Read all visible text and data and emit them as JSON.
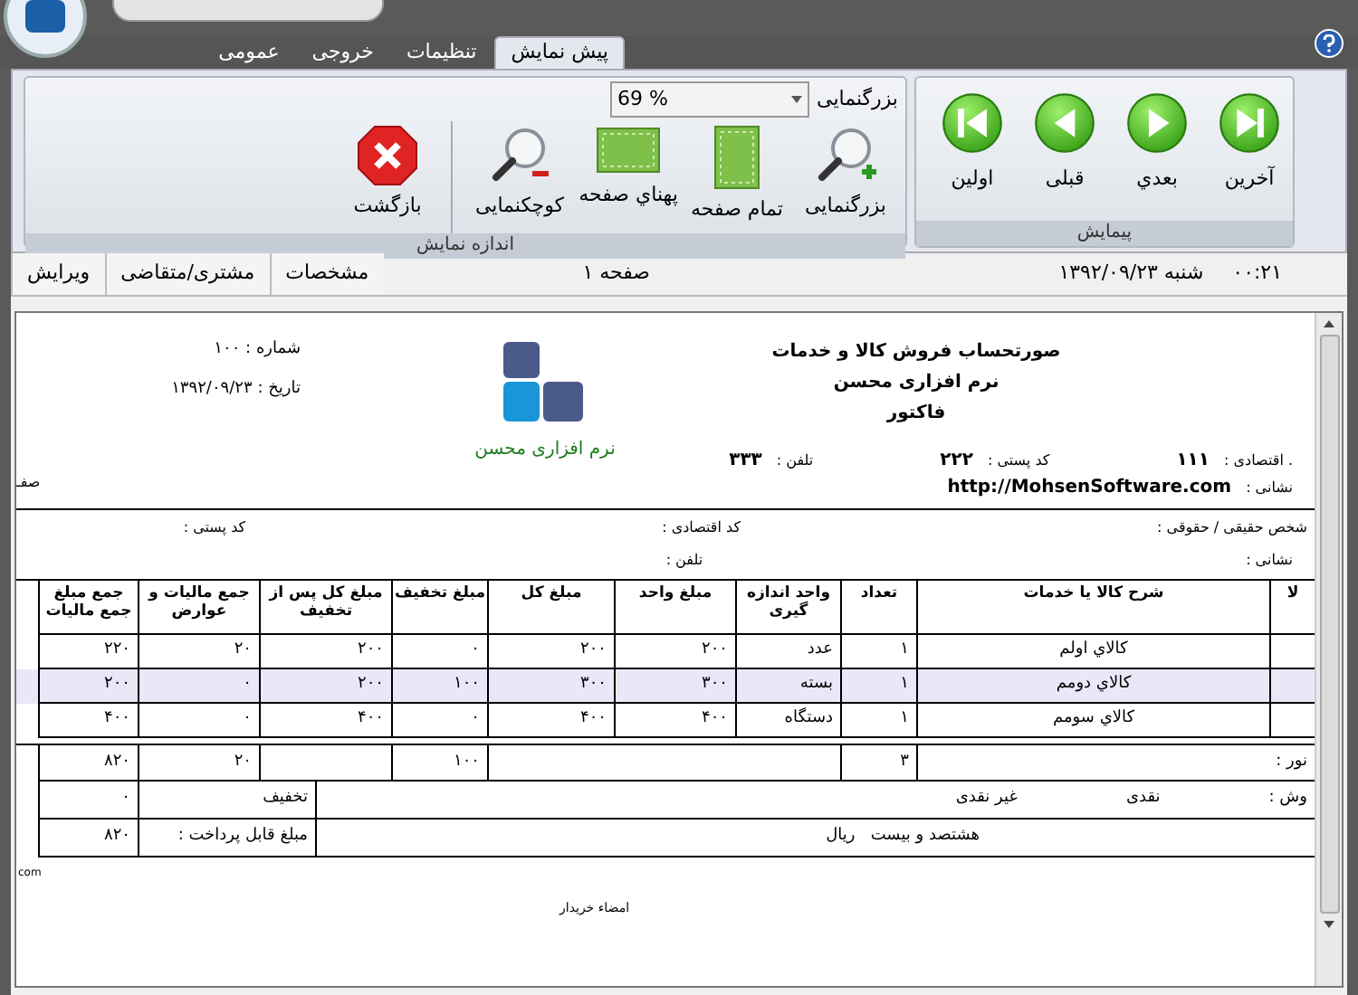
{
  "tabs": [
    {
      "label": "پیش نمایش",
      "selected": true
    },
    {
      "label": "تنظیمات",
      "selected": false
    },
    {
      "label": "خروجی",
      "selected": false
    },
    {
      "label": "عمومی",
      "selected": false
    }
  ],
  "ribbon": {
    "navigation": {
      "title": "پیمایش",
      "buttons": [
        {
          "label": "آخرین",
          "kind": "last"
        },
        {
          "label": "بعدي",
          "kind": "next"
        },
        {
          "label": "قبلی",
          "kind": "prev"
        },
        {
          "label": "اولین",
          "kind": "first"
        }
      ]
    },
    "view_size": {
      "title": "اندازه نمایش",
      "zoom": {
        "label": "بزرگنمایی",
        "value": "69 %"
      },
      "buttons": [
        {
          "label": "بزرگنمایی",
          "kind": "zoom_in"
        },
        {
          "label": "تمام صفحه",
          "kind": "full_page"
        },
        {
          "label": "پهناي صفحه",
          "kind": "page_width"
        },
        {
          "label": "کوچکنمایی",
          "kind": "zoom_out"
        },
        {
          "label": "بازگشت",
          "kind": "close"
        }
      ]
    }
  },
  "status_bar": {
    "time": "۰۰:۲۱",
    "date": "شنبه ۱۳۹۲/۰۹/۲۳",
    "page": "صفحه ۱",
    "buttons": [
      "مشخصات",
      "مشتری/متقاضی",
      "ویرایش"
    ]
  },
  "invoice": {
    "title_lines": [
      "صورتحساب فروش کالا و خدمات",
      "نرم افزاری محسن",
      "فاکتور"
    ],
    "logo_text": "نرم افزاری محسن",
    "number": "شماره : ۱۰۰",
    "date": "تاریخ : ۱۳۹۲/۰۹/۲۳",
    "edge_text": "صفـ",
    "seller": [
      {
        "label": ". اقتصادی :",
        "value": "۱۱۱"
      },
      {
        "label": "کد پستی :",
        "value": "۲۲۲"
      },
      {
        "label": "تلفن :",
        "value": "۳۳۳"
      }
    ],
    "address_label": "نشانی :",
    "address": "http://MohsenSoftware.com",
    "buyer": [
      "شخص حقیقی / حقوقی :",
      "کد اقتصادی :",
      "کد پستی :"
    ],
    "buyer_line2": [
      "نشانی :",
      "تلفن :"
    ],
    "table": {
      "columns": [
        "لا",
        "شرح کالا یا خدمات",
        "تعداد",
        "واحد اندازه گیری",
        "مبلغ واحد",
        "مبلغ کل",
        "مبلغ تخفیف",
        "مبلغ کل پس از تخفیف",
        "جمع مالیات و عوارض",
        "جمع مبلغ جمع مالیات"
      ],
      "rows": [
        {
          "cells": [
            "",
            "کالاي اولم",
            "۱",
            "عدد",
            "۲۰۰",
            "۲۰۰",
            "۰",
            "۲۰۰",
            "۲۰",
            "۲۲۰"
          ],
          "selected": false
        },
        {
          "cells": [
            "",
            "کالاي دومم",
            "۱",
            "بسته",
            "۳۰۰",
            "۳۰۰",
            "۱۰۰",
            "۲۰۰",
            "۰",
            "۲۰۰"
          ],
          "selected": true
        },
        {
          "cells": [
            "",
            "کالاي سومم",
            "۱",
            "دستگاه",
            "۴۰۰",
            "۴۰۰",
            "۰",
            "۴۰۰",
            "۰",
            "۴۰۰"
          ],
          "selected": false
        }
      ]
    },
    "totals": {
      "label": "نور :",
      "count": "۳",
      "discount": "۱۰۰",
      "tax": "۲۰",
      "total": "۸۲۰"
    },
    "payment": {
      "label": "وش :",
      "cash": "نقدی",
      "non_cash": "غیر نقدی",
      "discount_label": "تخفیف",
      "discount": "۰"
    },
    "payable": {
      "words": "هشتصد و بیست   ریال",
      "label": "مبلغ قابل پرداخت :",
      "value": "۸۲۰"
    },
    "footer_edge": "com",
    "signature": "امضاء خریدار"
  }
}
